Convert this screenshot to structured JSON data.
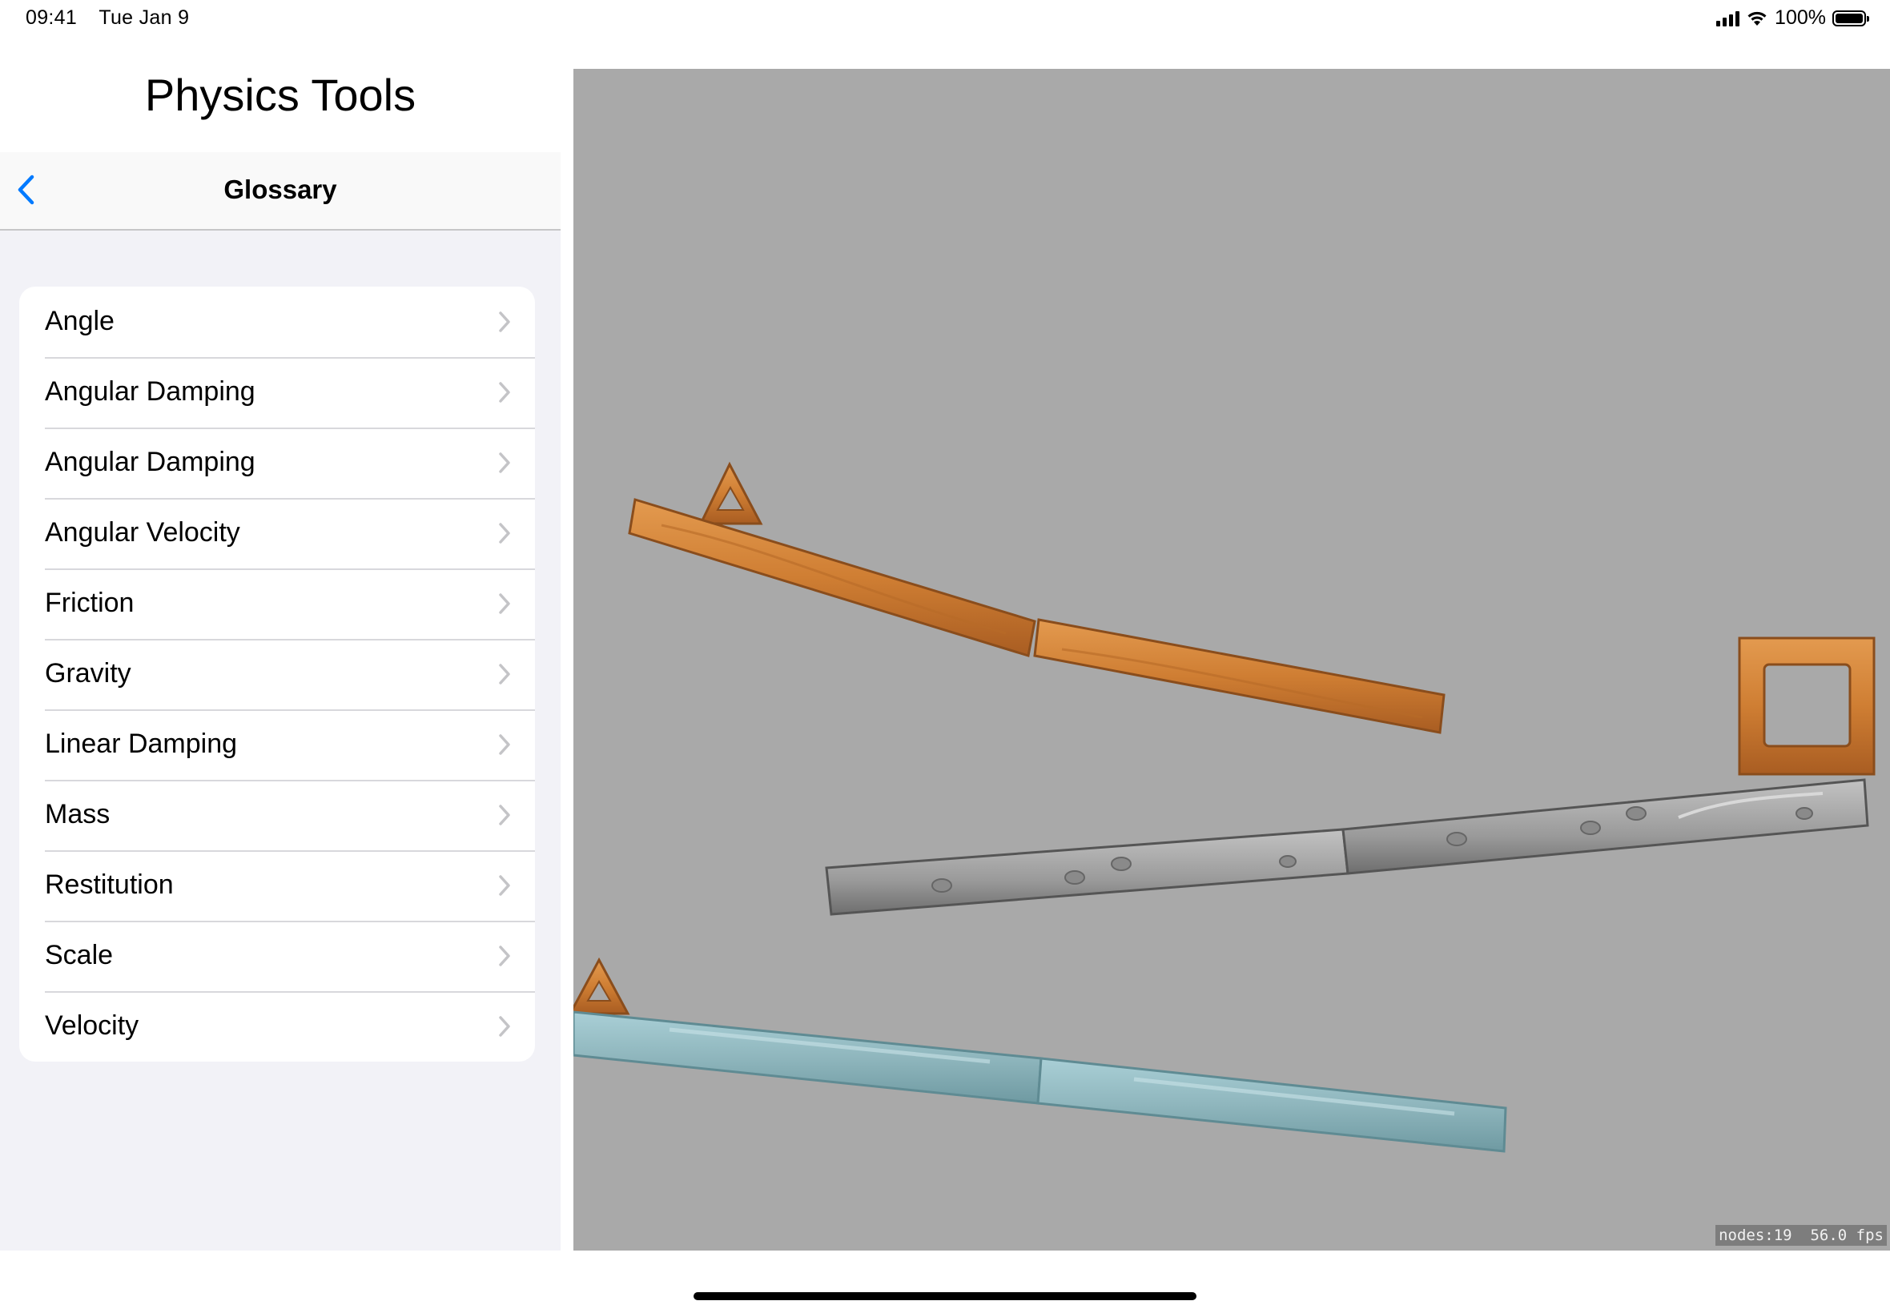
{
  "status_bar": {
    "time": "09:41",
    "date": "Tue Jan 9",
    "battery_text": "100%",
    "icons": [
      "cellular-signal-icon",
      "wifi-icon",
      "battery-icon"
    ]
  },
  "sidebar": {
    "app_title": "Physics Tools",
    "nav_title": "Glossary",
    "back_icon": "chevron-left-icon",
    "accent_color": "#007aff",
    "items": [
      {
        "label": "Angle"
      },
      {
        "label": "Angular Damping"
      },
      {
        "label": "Angular Damping"
      },
      {
        "label": "Angular Velocity"
      },
      {
        "label": "Friction"
      },
      {
        "label": "Gravity"
      },
      {
        "label": "Linear Damping"
      },
      {
        "label": "Mass"
      },
      {
        "label": "Restitution"
      },
      {
        "label": "Scale"
      },
      {
        "label": "Velocity"
      }
    ]
  },
  "scene": {
    "background": "#a9a9a9",
    "debug": {
      "nodes_label": "nodes:19",
      "fps_label": "56.0 fps"
    },
    "objects": [
      "wood-triangle",
      "wood-plank",
      "wood-plank",
      "wood-square-frame",
      "stone-plank",
      "stone-plank",
      "wood-triangle",
      "glass-plank",
      "glass-plank"
    ]
  }
}
